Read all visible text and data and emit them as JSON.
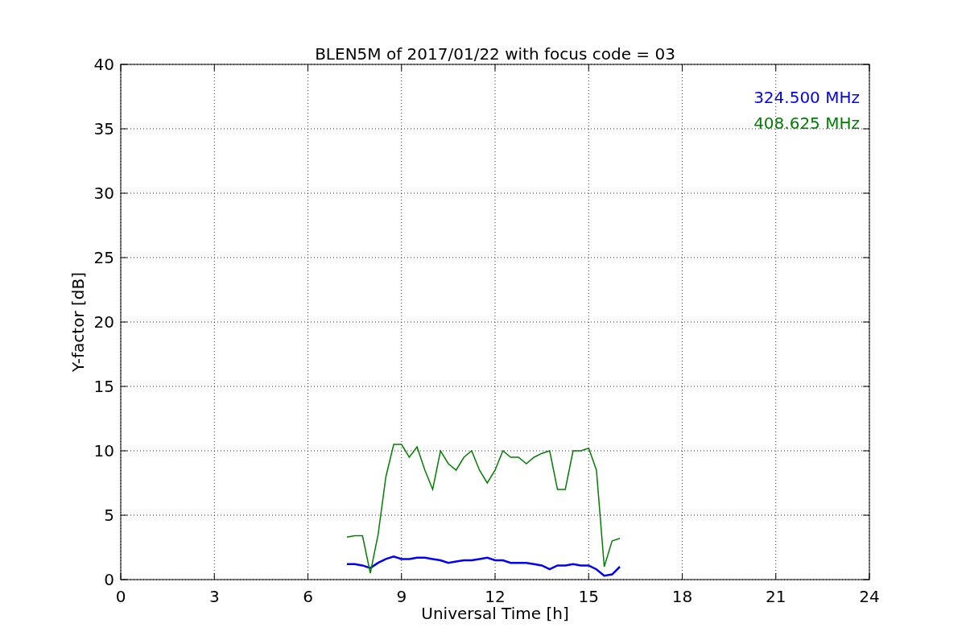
{
  "chart_data": {
    "type": "line",
    "title": "BLEN5M of 2017/01/22 with focus code = 03",
    "xlabel": "Universal Time [h]",
    "ylabel": "Y-factor [dB]",
    "x": [
      7.25,
      7.5,
      7.75,
      8.0,
      8.25,
      8.5,
      8.75,
      9.0,
      9.25,
      9.5,
      9.75,
      10.0,
      10.25,
      10.5,
      10.75,
      11.0,
      11.25,
      11.5,
      11.75,
      12.0,
      12.25,
      12.5,
      12.75,
      13.0,
      13.25,
      13.5,
      13.75,
      14.0,
      14.25,
      14.5,
      14.75,
      15.0,
      15.25,
      15.5,
      15.75,
      16.0
    ],
    "series": [
      {
        "name": "324.500 MHz",
        "color": "#0000ff",
        "values": [
          1.2,
          1.2,
          1.1,
          0.9,
          1.3,
          1.6,
          1.8,
          1.6,
          1.6,
          1.7,
          1.7,
          1.6,
          1.5,
          1.3,
          1.4,
          1.5,
          1.5,
          1.6,
          1.7,
          1.5,
          1.5,
          1.3,
          1.3,
          1.3,
          1.2,
          1.1,
          0.8,
          1.1,
          1.1,
          1.2,
          1.1,
          1.1,
          0.8,
          0.3,
          0.4,
          1.0
        ]
      },
      {
        "name": "408.625 MHz",
        "color": "#008000",
        "values": [
          3.3,
          3.4,
          3.4,
          0.5,
          3.5,
          8.0,
          10.5,
          10.5,
          9.5,
          10.3,
          8.5,
          7.0,
          10.0,
          9.0,
          8.5,
          9.5,
          10.0,
          8.5,
          7.5,
          8.5,
          10.0,
          9.5,
          9.5,
          9.0,
          9.5,
          9.8,
          10.0,
          7.0,
          7.0,
          10.0,
          10.0,
          10.2,
          8.5,
          1.0,
          3.0,
          3.2
        ]
      }
    ],
    "grid": true,
    "xlim": [
      0,
      24
    ],
    "ylim": [
      0,
      40
    ],
    "xticks": [
      0,
      3,
      6,
      9,
      12,
      15,
      18,
      21,
      24
    ],
    "yticks": [
      0,
      5,
      10,
      15,
      20,
      25,
      30,
      35,
      40
    ]
  }
}
